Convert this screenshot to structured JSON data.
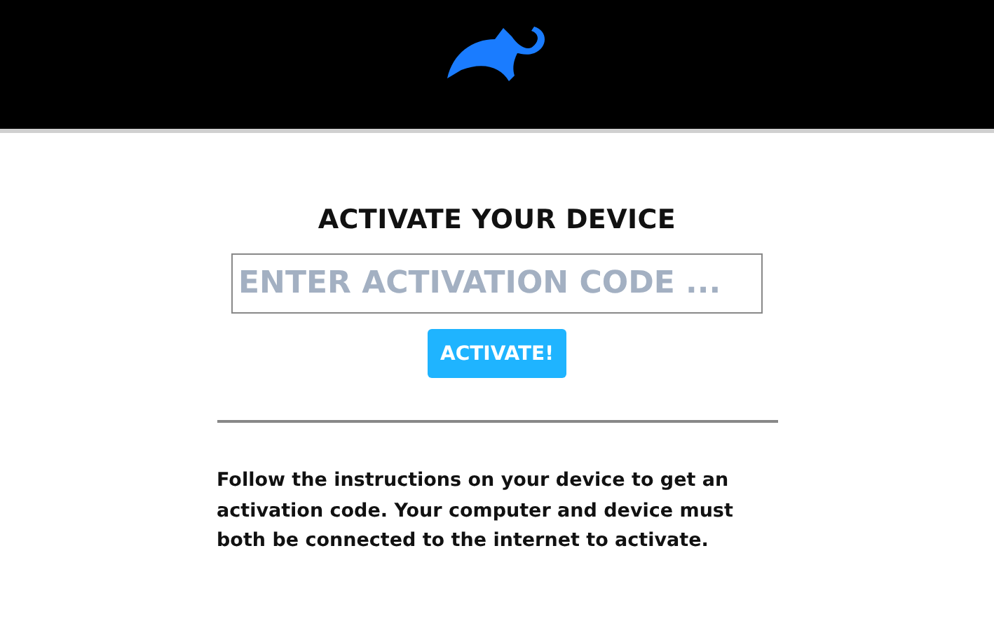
{
  "activation": {
    "title": "ACTIVATE YOUR DEVICE",
    "code_field": {
      "placeholder": "ENTER ACTIVATION CODE ..."
    },
    "activate_button": "ACTIVATE!",
    "instructions": "Follow the instructions on your device to get an activation code. Your computer and device must both be connected to the internet to activate."
  }
}
